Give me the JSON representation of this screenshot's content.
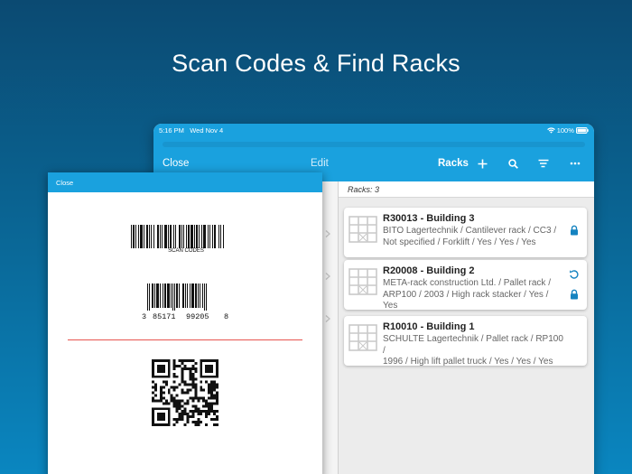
{
  "headline": "Scan Codes & Find Racks",
  "tablet": {
    "status": {
      "time": "5:16 PM",
      "date": "Wed Nov 4",
      "battery": "100%"
    },
    "nav": {
      "close": "Close",
      "edit": "Edit",
      "title": "Racks"
    },
    "icons": [
      "add-icon",
      "search-icon",
      "sort-icon",
      "more-icon"
    ],
    "racks_count": "Racks: 3",
    "racks": [
      {
        "title": "R30013 - Building 3",
        "line1": "BITO Lagertechnik / Cantilever rack / CC3 /",
        "line2": "Not specified / Forklift / Yes / Yes / Yes",
        "icons": [
          "lock-icon"
        ]
      },
      {
        "title": "R20008 - Building 2",
        "line1": "META-rack construction Ltd. / Pallet rack /",
        "line2": "ARP100 / 2003 / High rack stacker / Yes / Yes",
        "icons": [
          "refresh-icon",
          "lock-icon"
        ]
      },
      {
        "title": "R10010 - Building 1",
        "line1": "SCHULTE Lagertechnik / Pallet rack / RP100 /",
        "line2": "1996 / High lift pallet truck / Yes / Yes / Yes",
        "icons": []
      }
    ]
  },
  "modal": {
    "close": "Close",
    "barcode1_label": "SCAN CODES",
    "barcode2_digits": {
      "first": "3",
      "left": "85171",
      "right": "99205",
      "last": "8"
    }
  },
  "colors": {
    "accent": "#1aa1de",
    "scan_line": "#e8544f",
    "lock": "#1583c0"
  }
}
